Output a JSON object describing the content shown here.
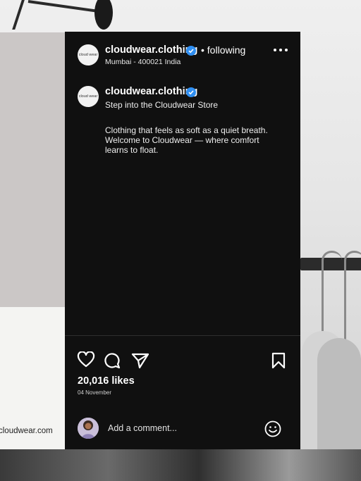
{
  "post": {
    "account": {
      "handle": "cloudwear.clothing",
      "logo_text": "cloud wear",
      "follow_status": "• following",
      "location": "Mumbai - 400021 India"
    },
    "caption": {
      "handle": "cloudwear.clothing",
      "tagline": "Step into the Cloudwear Store",
      "body": "Clothing that feels as soft as a quiet breath. Welcome to Cloudwear — where comfort learns to float."
    },
    "actions": {
      "like_icon": "heart-icon",
      "comment_icon": "comment-icon",
      "share_icon": "send-icon",
      "save_icon": "bookmark-icon"
    },
    "likes": "20,016 likes",
    "date": "04 November",
    "comment_placeholder": "Add a comment...",
    "emoji_icon": "smiley-icon"
  },
  "background": {
    "url_text": "cloudwear.com"
  },
  "colors": {
    "card_bg": "#101010",
    "verified": "#2f8ff2",
    "text": "#ffffff"
  }
}
